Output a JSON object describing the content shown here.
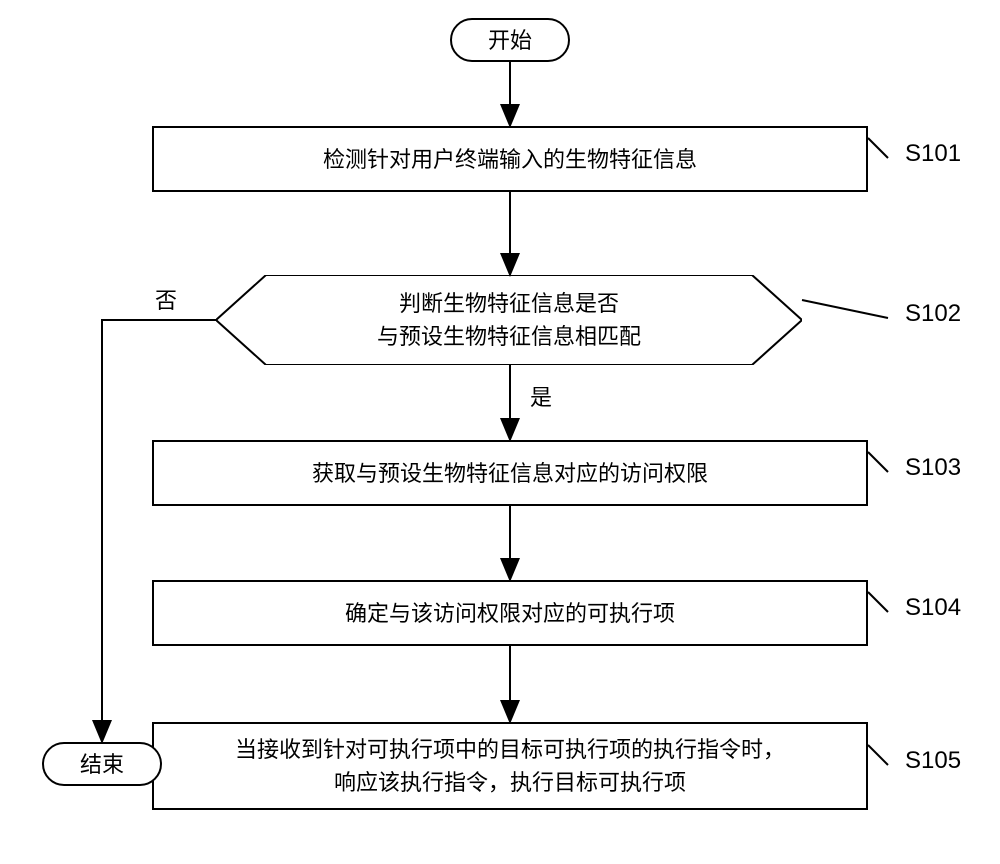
{
  "terminal": {
    "start": "开始",
    "end": "结束"
  },
  "steps": {
    "s101": {
      "text": "检测针对用户终端输入的生物特征信息",
      "label": "S101"
    },
    "s102": {
      "text_line1": "判断生物特征信息是否",
      "text_line2": "与预设生物特征信息相匹配",
      "label": "S102"
    },
    "s103": {
      "text": "获取与预设生物特征信息对应的访问权限",
      "label": "S103"
    },
    "s104": {
      "text": "确定与该访问权限对应的可执行项",
      "label": "S104"
    },
    "s105": {
      "text_line1": "当接收到针对可执行项中的目标可执行项的执行指令时，",
      "text_line2": "响应该执行指令，执行目标可执行项",
      "label": "S105"
    }
  },
  "branch": {
    "yes": "是",
    "no": "否"
  }
}
